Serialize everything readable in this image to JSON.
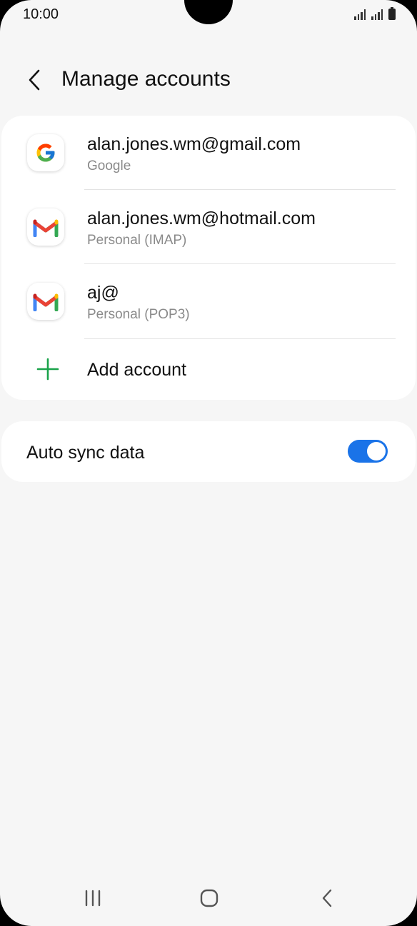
{
  "status_bar": {
    "time": "10:00",
    "icons": [
      "signal-icon",
      "signal-icon",
      "battery-icon"
    ]
  },
  "header": {
    "back_icon": "back-arrow-icon",
    "title": "Manage accounts"
  },
  "accounts": [
    {
      "email": "alan.jones.wm@gmail.com",
      "type": "Google",
      "icon": "google-icon"
    },
    {
      "email": "alan.jones.wm@hotmail.com",
      "type": "Personal (IMAP)",
      "icon": "gmail-icon"
    },
    {
      "email": "aj@",
      "type": "Personal (POP3)",
      "icon": "gmail-icon"
    }
  ],
  "add_account": {
    "label": "Add account",
    "icon": "plus-icon"
  },
  "auto_sync": {
    "label": "Auto sync data",
    "enabled": true
  },
  "nav_bar": {
    "icons": [
      "recents-icon",
      "home-icon",
      "back-icon"
    ]
  },
  "colors": {
    "background": "#f6f6f6",
    "card": "#ffffff",
    "accent_blue": "#1a73e8",
    "add_green": "#1aa34a",
    "secondary_text": "#8a8a8a"
  }
}
